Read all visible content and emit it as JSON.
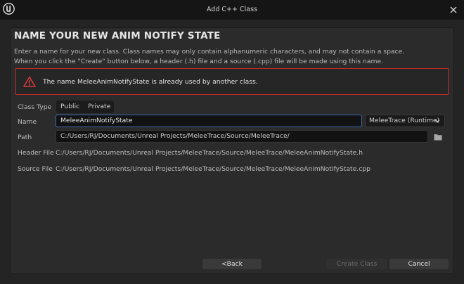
{
  "window": {
    "title": "Add C++ Class",
    "logo_icon": "unreal-logo-icon",
    "close_icon": "close-icon"
  },
  "heading": "NAME YOUR NEW ANIM NOTIFY STATE",
  "description": {
    "line1": "Enter a name for your new class. Class names may only contain alphanumeric characters, and may not contain a space.",
    "line2": "When you click the \"Create\" button below, a header (.h) file and a source (.cpp) file will be made using this name."
  },
  "error": {
    "icon": "warning-icon",
    "message": "The name MeleeAnimNotifyState is already used by another class.",
    "border_color": "#c22b2b"
  },
  "form": {
    "class_type_label": "Class Type",
    "class_type_options": [
      "Public",
      "Private"
    ],
    "name_label": "Name",
    "name_value": "MeleeAnimNotifyState",
    "module_value": "MeleeTrace (Runtime)",
    "path_label": "Path",
    "path_value": "C:/Users/RJ/Documents/Unreal Projects/MeleeTrace/Source/MeleeTrace/",
    "header_label": "Header File",
    "header_value": "C:/Users/RJ/Documents/Unreal Projects/MeleeTrace/Source/MeleeTrace/MeleeAnimNotifyState.h",
    "source_label": "Source File",
    "source_value": "C:/Users/RJ/Documents/Unreal Projects/MeleeTrace/Source/MeleeTrace/MeleeAnimNotifyState.cpp"
  },
  "buttons": {
    "back": "<Back",
    "create": "Create Class",
    "cancel": "Cancel"
  },
  "colors": {
    "accent": "#3d6ab5",
    "background": "#242424"
  }
}
